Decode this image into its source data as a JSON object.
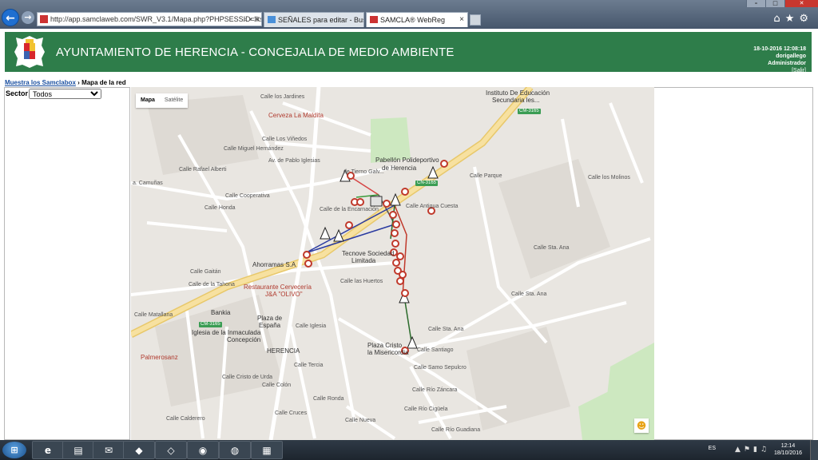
{
  "browser": {
    "address_url": "http://app.samclaweb.com/SWR_V3.1/Mapa.php?PHPSESSID=lks9i4",
    "tabs": [
      {
        "label": "SEÑALES para editar - Buscar c..."
      },
      {
        "label": "SAMCLA® WebReg"
      }
    ]
  },
  "header": {
    "title": "AYUNTAMIENTO DE HERENCIA - CONCEJALIA DE MEDIO AMBIENTE",
    "datetime": "18-10-2016 12:08:18",
    "user": "dorigallego",
    "role": "Administrador",
    "logout_label": "[Salir]"
  },
  "breadcrumb": {
    "home_link": "Muestra los Samclabox",
    "separator": "›",
    "current": "Mapa de la red"
  },
  "filter": {
    "label": "Sector",
    "selected": "Todos"
  },
  "map": {
    "type_buttons": [
      {
        "label": "Mapa",
        "selected": true
      },
      {
        "label": "Satélite",
        "selected": false
      }
    ],
    "labels": {
      "pabellon": "Pabellón Polideportivo",
      "herencia_poli": "de Herencia",
      "instituto": "Instituto De Educación",
      "instituto2": "Secundaria les...",
      "cerveza": "Cerveza La Maldita",
      "tecnove": "Tecnove Sociedad",
      "limitada": "Limitada",
      "ahorramas": "Ahorramas S.A",
      "restaurante": "Restaurante Cervecería",
      "olivo": "J&A \"OLIVO\"",
      "bankia": "Bankia",
      "plaza_espana": "Plaza de",
      "espana": "España",
      "iglesia": "Iglesia de la Inmaculada",
      "concepcion": "Concepción",
      "herencia": "HERENCIA",
      "plaza_cristo": "Plaza Cristo",
      "misericordia": "la Misericordia",
      "palmerosanz": "Palmerosanz",
      "cm3165a": "CM-3165",
      "cm3165b": "CM-3165",
      "cm3165c": "CM-3165",
      "camunas": "a. Camuñas",
      "calle_honda": "Calle Honda",
      "calle_cooperativa": "Calle Cooperativa",
      "calle_rafael": "Calle Rafael Alberti",
      "calle_miguel": "Calle Miguel Hernández",
      "calle_jardines": "Calle los Jardines",
      "calle_vinedos": "Calle Los Viñedos",
      "av_pablo": "Av. de Pablo Iglesias",
      "calle_gaitan": "Calle Gaitán",
      "calle_tahona": "Calle de la Tahona",
      "calle_matallana": "Calle Matallana",
      "calle_iglesia": "Calle Iglesia",
      "calle_tercia": "Calle Tercia",
      "calle_cristo_urda": "Calle Cristo de Urda",
      "calle_colon": "Calle Colón",
      "calle_ronda": "Calle Ronda",
      "calle_calderero": "Calle Calderero",
      "calle_cruces": "Calle Cruces",
      "calle_nueva": "Calle Nueva",
      "calle_santiago": "Calle Santiago",
      "calle_samo": "Calle Samo Sepulcro",
      "calle_rio_zancara": "Calle Río Záncara",
      "calle_rio_cigüela": "Calle Río Cigüela",
      "calle_rio_guadiana": "Calle Río Guadiana",
      "calle_sta_ana": "Calle Sta. Ana",
      "calle_sta_ana2": "Calle Sta. Ana",
      "calle_sta_ana3": "Calle Sta. Ana",
      "calle_parque": "Calle Parque",
      "calle_molinos": "Calle los Molinos",
      "calle_huertos": "Calle las Huertos",
      "calle_encarnacion": "Calle de la Encarnación",
      "calle_tierno": "de Tierno Galv...",
      "cn3165": "CN-3165",
      "calle_antigua": "Calle Antigua Cuesta"
    }
  },
  "taskbar": {
    "language": "ES",
    "time": "12:14",
    "date": "18/10/2016"
  },
  "colors": {
    "header_green": "#2e7d4a",
    "link_blue": "#1a4fa0",
    "marker_red": "#c0392b",
    "road_yellow": "#f5dc8c",
    "park_green": "#c7e6b9"
  }
}
